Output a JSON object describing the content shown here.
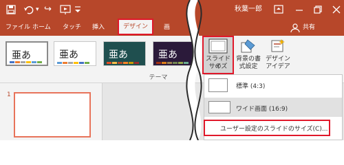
{
  "title_bar": {
    "user_name": "秋葉一郎",
    "redo_glyph": "↪",
    "more_glyph": "▾"
  },
  "tabs": {
    "file": "ファイル",
    "home": "ホーム",
    "touch": "タッチ",
    "insert": "挿入",
    "design": "デザイン",
    "transitions_partial": "画",
    "share": "共有"
  },
  "ribbon": {
    "themes": [
      {
        "glyph": "亜あ"
      },
      {
        "glyph": "亜あ"
      },
      {
        "glyph": "亜あ"
      },
      {
        "glyph": "亜あ"
      }
    ],
    "group_label": "テーマ",
    "slide_size_line1": "スライドの",
    "slide_size_line2": "サイズ",
    "bg_format_line1": "背景の書",
    "bg_format_line2": "式設定",
    "design_ideas_line1": "デザイン",
    "design_ideas_line2": "アイデア"
  },
  "thumbnails": {
    "slide_number": "1"
  },
  "dropdown": {
    "standard": "標準 (4:3)",
    "widescreen": "ワイド画面 (16:9)",
    "custom": "ユーザー設定のスライドのサイズ(C)..."
  },
  "colors": {
    "ribbon_red": "#b7472a",
    "highlight_red": "#e0182a"
  }
}
